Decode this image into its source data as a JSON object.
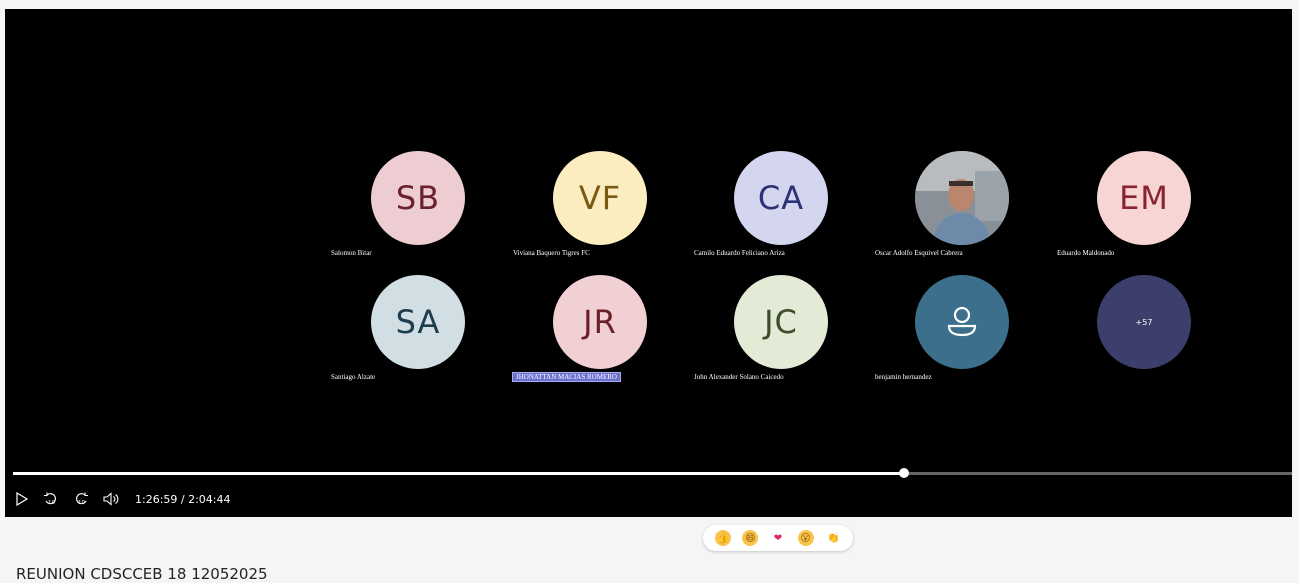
{
  "participants": [
    {
      "initials": "SB",
      "name": "Salomon Bitar",
      "bg": "#edcdd2",
      "fg": "#6b2030"
    },
    {
      "initials": "VF",
      "name": "Viviana Baquero Tigres FC",
      "bg": "#fbedc0",
      "fg": "#7a5a10"
    },
    {
      "initials": "CA",
      "name": "Camilo Eduardo Feliciano Ariza",
      "bg": "#d4d6ef",
      "fg": "#2d3275"
    },
    {
      "initials": "",
      "name": "Oscar Adolfo Esquivel Cabrera",
      "bg": "#6e7680",
      "fg": "#ffffff",
      "photo": true
    },
    {
      "initials": "EM",
      "name": "Eduardo Maldonado",
      "bg": "#f6d5d3",
      "fg": "#8a2330"
    },
    {
      "initials": "SA",
      "name": "Santiago Alzate",
      "bg": "#d1dfe5",
      "fg": "#1d3d4d"
    },
    {
      "initials": "JR",
      "name": "JHONATTAN MACIAS ROMERO",
      "bg": "#f0d0d3",
      "fg": "#6b2028",
      "highlight": true
    },
    {
      "initials": "JC",
      "name": "John Alexander Solano Caicedo",
      "bg": "#e3ead6",
      "fg": "#3d4d2a"
    },
    {
      "initials": "",
      "name": "benjamin hernandez",
      "bg": "#3b6f8b",
      "fg": "#ffffff",
      "icon": "person-icon"
    },
    {
      "initials": "+57",
      "name": "",
      "bg": "#3c3f6b",
      "fg": "#ffffff",
      "more": true
    }
  ],
  "player": {
    "current_time": "1:26:59",
    "duration": "2:04:44",
    "time_display": "1:26:59 / 2:04:44",
    "progress": 0.697
  },
  "controls": [
    "play-icon",
    "rewind-10-icon",
    "forward-10-icon",
    "volume-icon"
  ],
  "reactions": [
    {
      "name": "like-reaction",
      "glyph": "👍",
      "bg": "#f8c34a"
    },
    {
      "name": "laugh-reaction",
      "glyph": "😄",
      "bg": "#f8c34a"
    },
    {
      "name": "heart-reaction",
      "glyph": "❤",
      "bg": "#ffffff"
    },
    {
      "name": "surprised-reaction",
      "glyph": "😮",
      "bg": "#f8c34a"
    },
    {
      "name": "clap-reaction",
      "glyph": "👏",
      "bg": "#ffffff"
    }
  ],
  "meeting_title": "REUNION CDSCCEB 18 12052025"
}
